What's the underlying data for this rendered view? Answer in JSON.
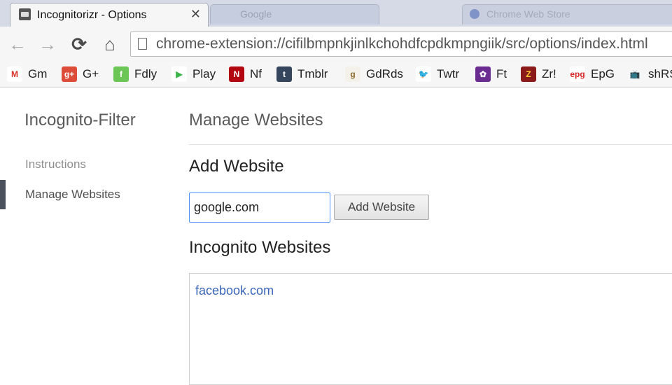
{
  "browser": {
    "active_tab_title": "Incognitorizr - Options",
    "close_glyph": "✕",
    "background_tab_title": "Google",
    "background_tab2_title": "Chrome Web Store",
    "url": "chrome-extension://cifilbmpnkjinlkchohdfcpdkmpngiik/src/options/index.html",
    "nav_icons": {
      "back": "←",
      "forward": "→",
      "reload": "⟳",
      "home": "⌂"
    }
  },
  "bookmarks": [
    {
      "label": "Gm",
      "glyph": "M",
      "color": "#ffffff",
      "text_color": "#d93025",
      "icon": "gmail-icon"
    },
    {
      "label": "G+",
      "glyph": "g+",
      "color": "#dd4b39",
      "text_color": "#ffffff",
      "icon": "google-plus-icon"
    },
    {
      "label": "Fdly",
      "glyph": "f",
      "color": "#6cc655",
      "text_color": "#ffffff",
      "icon": "feedly-icon"
    },
    {
      "label": "Play",
      "glyph": "▶",
      "color": "#ffffff",
      "text_color": "#3bb54a",
      "icon": "play-store-icon"
    },
    {
      "label": "Nf",
      "glyph": "N",
      "color": "#b20710",
      "text_color": "#ffffff",
      "icon": "netflix-icon"
    },
    {
      "label": "Tmblr",
      "glyph": "t",
      "color": "#35465c",
      "text_color": "#ffffff",
      "icon": "tumblr-icon"
    },
    {
      "label": "GdRds",
      "glyph": "g",
      "color": "#f4f1ea",
      "text_color": "#8a6a2a",
      "icon": "goodreads-icon"
    },
    {
      "label": "Twtr",
      "glyph": "🐦",
      "color": "#ffffff",
      "text_color": "#1da1f2",
      "icon": "twitter-icon"
    },
    {
      "label": "Ft",
      "glyph": "✿",
      "color": "#6b2c91",
      "text_color": "#ffffff",
      "icon": "ft-icon"
    },
    {
      "label": "Zr!",
      "glyph": "Z",
      "color": "#8b1a1a",
      "text_color": "#ffcc33",
      "icon": "zr-icon"
    },
    {
      "label": "EpG",
      "glyph": "epg",
      "color": "#ffffff",
      "text_color": "#d62828",
      "icon": "epg-icon"
    },
    {
      "label": "shRS",
      "glyph": "📺",
      "color": "#f6f6f6",
      "text_color": "#e09b1a",
      "icon": "tv-icon"
    }
  ],
  "sidebar": {
    "title": "Incognito-Filter",
    "items": [
      {
        "label": "Instructions"
      },
      {
        "label": "Manage Websites"
      }
    ]
  },
  "main": {
    "page_title": "Manage Websites",
    "add_heading": "Add Website",
    "input_value": "google.com",
    "add_button_label": "Add Website",
    "list_heading": "Incognito Websites",
    "websites": [
      "facebook.com"
    ]
  }
}
